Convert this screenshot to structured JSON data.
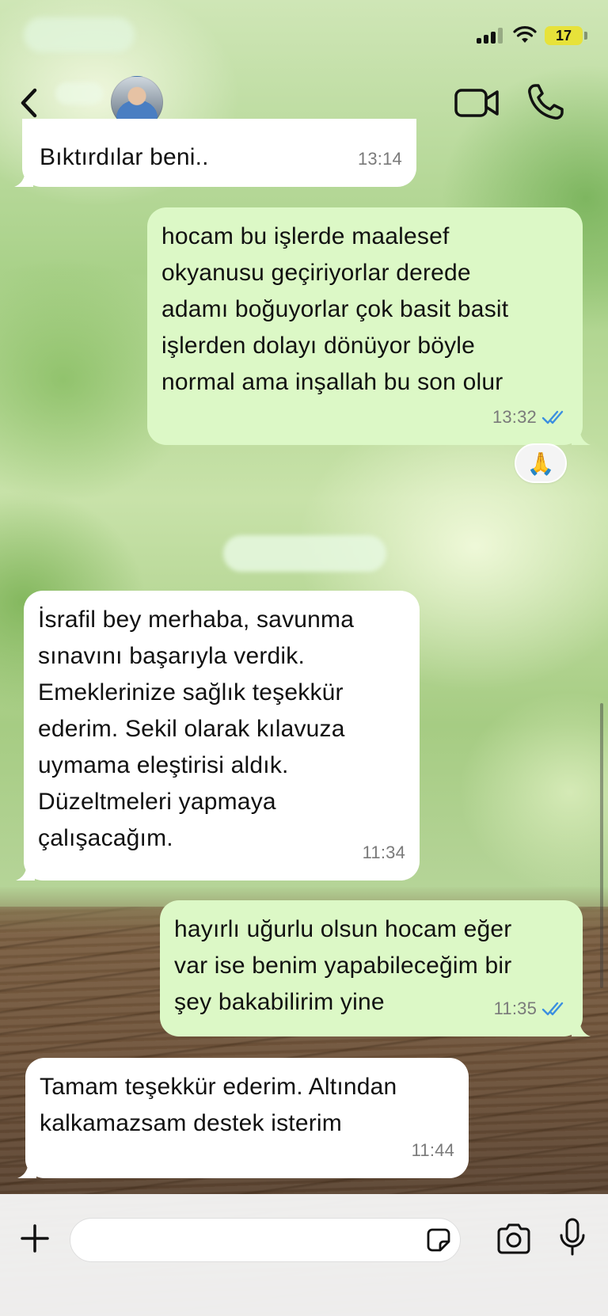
{
  "status_bar": {
    "battery_level": "17",
    "signal_bars": 3,
    "signal_bars_total": 4
  },
  "header": {
    "icons": {
      "back": "chevron-left-icon",
      "video": "video-camera-icon",
      "call": "phone-icon"
    }
  },
  "messages": [
    {
      "direction": "incoming",
      "text": "Bıktırdılar beni..",
      "time": "13:14"
    },
    {
      "direction": "outgoing",
      "text": "hocam bu işlerde maalesef\nokyanusu geçiriyorlar derede\nadamı boğuyorlar çok basit basit\nişlerden dolayı dönüyor böyle\nnormal ama inşallah bu son olur",
      "time": "13:32",
      "read": true,
      "reaction": "🙏"
    },
    {
      "direction": "incoming",
      "text": "İsrafil bey merhaba, savunma\nsınavını başarıyla verdik.\nEmeklerinize sağlık teşekkür\nederim. Sekil olarak kılavuza\nuymama eleştirisi aldık.\nDüzeltmeleri yapmaya\nçalışacağım.",
      "time": "11:34"
    },
    {
      "direction": "outgoing",
      "text": "hayırlı uğurlu olsun hocam eğer\nvar ise benim yapabileceğim bir\nşey bakabilirim yine",
      "time": "11:35",
      "read": true
    },
    {
      "direction": "incoming",
      "text": "Tamam teşekkür ederim. Altından\nkalkamazsam destek isterim",
      "time": "11:44"
    }
  ],
  "composer": {
    "value": "",
    "placeholder": "",
    "icons": {
      "attach": "plus-icon",
      "sticker": "sticker-icon",
      "camera": "camera-icon",
      "mic": "microphone-icon"
    }
  },
  "colors": {
    "incoming_bubble": "#ffffff",
    "outgoing_bubble": "#dcf8c6",
    "read_ticks": "#3b8fe0",
    "timestamp": "#7a7a7a"
  }
}
